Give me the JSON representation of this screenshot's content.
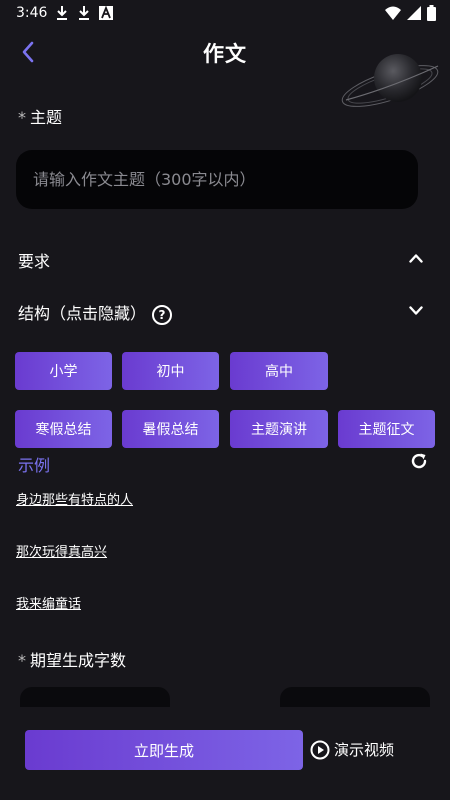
{
  "status_bar": {
    "time": "3:46",
    "icons": [
      "download-icon",
      "download-icon",
      "font-icon",
      "wifi-icon",
      "signal-icon",
      "battery-icon"
    ]
  },
  "header": {
    "title": "作文",
    "back_icon": "chevron-left-icon"
  },
  "topic": {
    "required_mark": "*",
    "label": "主题",
    "input_value": "",
    "placeholder": "请输入作文主题（300字以内）"
  },
  "requirements": {
    "label": "要求",
    "toggle_icon": "chevron-up-icon"
  },
  "structure": {
    "label": "结构（点击隐藏）",
    "help_icon": "question-circle-icon",
    "toggle_icon": "chevron-down-icon",
    "chips_row1": [
      "小学",
      "初中",
      "高中"
    ],
    "chips_row2": [
      "寒假总结",
      "暑假总结",
      "主题演讲",
      "主题征文"
    ]
  },
  "examples": {
    "title": "示例",
    "refresh_icon": "refresh-icon",
    "items": [
      "身边那些有特点的人",
      "那次玩得真高兴",
      "我来编童话"
    ]
  },
  "word_count": {
    "required_mark": "*",
    "label": "期望生成字数"
  },
  "footer": {
    "generate_label": "立即生成",
    "demo_label": "演示视频",
    "demo_icon": "play-circle-icon"
  },
  "colors": {
    "background": "#17161b",
    "input_background": "#050507",
    "accent_start": "#6a3bd0",
    "accent_end": "#7d64e6",
    "example_title": "#7b73f0"
  }
}
